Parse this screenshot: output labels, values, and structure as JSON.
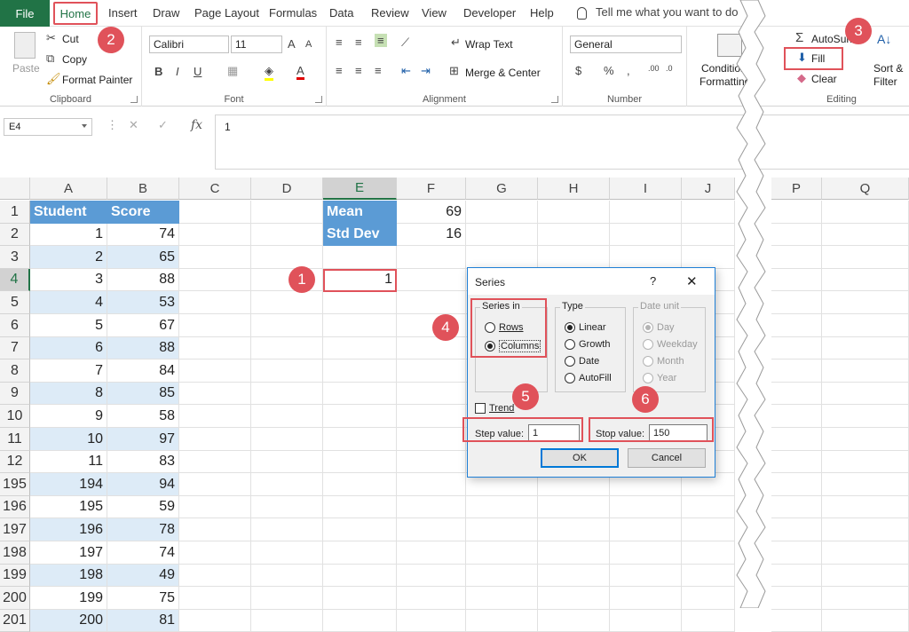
{
  "menu": {
    "file": "File",
    "home": "Home",
    "insert": "Insert",
    "draw": "Draw",
    "page_layout": "Page Layout",
    "formulas": "Formulas",
    "data": "Data",
    "review": "Review",
    "view": "View",
    "developer": "Developer",
    "help": "Help",
    "tell_me": "Tell me what you want to do"
  },
  "ribbon": {
    "clipboard": {
      "paste": "Paste",
      "cut": "Cut",
      "copy": "Copy",
      "format_painter": "Format Painter",
      "label": "Clipboard"
    },
    "font": {
      "name": "Calibri",
      "size": "11",
      "label": "Font"
    },
    "alignment": {
      "wrap_text": "Wrap Text",
      "merge_center": "Merge & Center",
      "label": "Alignment"
    },
    "number": {
      "format": "General",
      "label": "Number"
    },
    "styles": {
      "conditional": "Conditional",
      "formatting": "Formatting"
    },
    "editing": {
      "autosum": "AutoSum",
      "fill": "Fill",
      "clear": "Clear",
      "sort_filter_1": "Sort &",
      "sort_filter_2": "Filter",
      "label": "Editing"
    }
  },
  "formula_bar": {
    "name_box": "E4",
    "value": "1"
  },
  "columns": [
    "A",
    "B",
    "C",
    "D",
    "E",
    "F",
    "G",
    "H",
    "I",
    "J",
    "P",
    "Q"
  ],
  "table_header": {
    "student": "Student",
    "score": "Score"
  },
  "rows": [
    {
      "row": "1"
    },
    {
      "row": "2",
      "student": "1",
      "score": "74"
    },
    {
      "row": "3",
      "student": "2",
      "score": "65"
    },
    {
      "row": "4",
      "student": "3",
      "score": "88"
    },
    {
      "row": "5",
      "student": "4",
      "score": "53"
    },
    {
      "row": "6",
      "student": "5",
      "score": "67"
    },
    {
      "row": "7",
      "student": "6",
      "score": "88"
    },
    {
      "row": "8",
      "student": "7",
      "score": "84"
    },
    {
      "row": "9",
      "student": "8",
      "score": "85"
    },
    {
      "row": "10",
      "student": "9",
      "score": "58"
    },
    {
      "row": "11",
      "student": "10",
      "score": "97"
    },
    {
      "row": "12",
      "student": "11",
      "score": "83"
    },
    {
      "row": "195",
      "student": "194",
      "score": "94"
    },
    {
      "row": "196",
      "student": "195",
      "score": "59"
    },
    {
      "row": "197",
      "student": "196",
      "score": "78"
    },
    {
      "row": "198",
      "student": "197",
      "score": "74"
    },
    {
      "row": "199",
      "student": "198",
      "score": "49"
    },
    {
      "row": "200",
      "student": "199",
      "score": "75"
    },
    {
      "row": "201",
      "student": "200",
      "score": "81"
    }
  ],
  "stats": {
    "mean_label": "Mean",
    "mean_value": "69",
    "std_label": "Std Dev",
    "std_value": "16"
  },
  "active_cell": {
    "value": "1"
  },
  "dialog": {
    "title": "Series",
    "help": "?",
    "close": "✕",
    "series_in": "Series in",
    "rows": "Rows",
    "columns": "Columns",
    "type": "Type",
    "linear": "Linear",
    "growth": "Growth",
    "date": "Date",
    "autofill": "AutoFill",
    "date_unit": "Date unit",
    "day": "Day",
    "weekday": "Weekday",
    "month": "Month",
    "year": "Year",
    "trend": "Trend",
    "step_label": "Step value:",
    "step_value": "1",
    "stop_label": "Stop value:",
    "stop_value": "150",
    "ok": "OK",
    "cancel": "Cancel"
  },
  "steps": [
    "1",
    "2",
    "3",
    "4",
    "5",
    "6"
  ],
  "colors": {
    "excel_green": "#217346",
    "header_blue": "#5b9bd5",
    "band_blue": "#ddebf7",
    "callout_red": "#e0525a"
  }
}
